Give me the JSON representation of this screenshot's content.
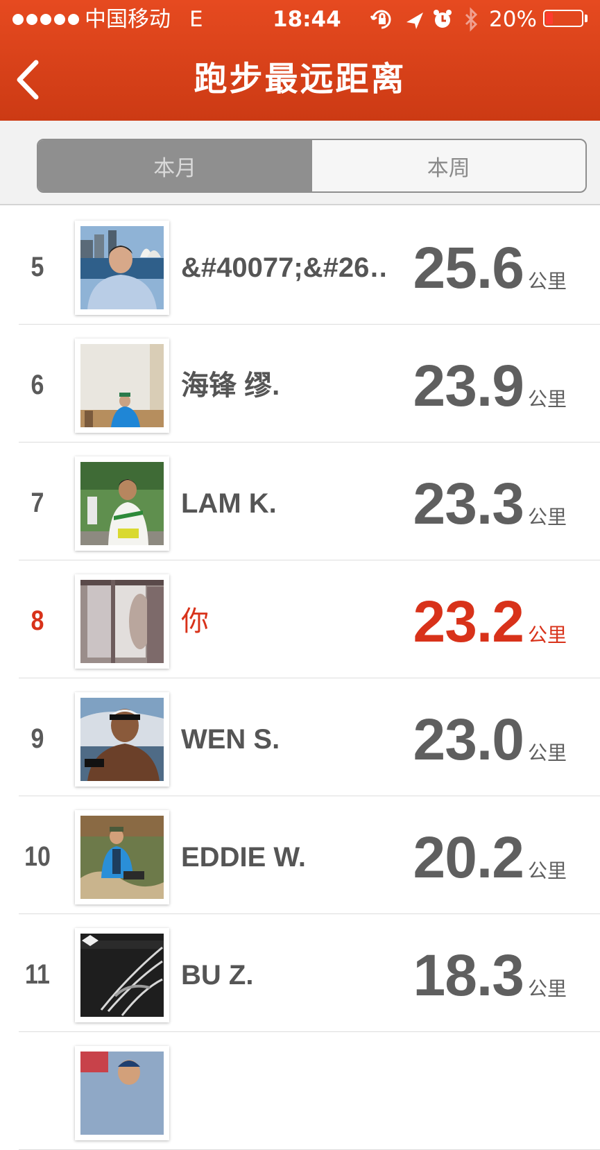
{
  "status_bar": {
    "carrier": "中国移动",
    "network": "E",
    "time": "18:44",
    "battery_percent": "20%",
    "battery_level": 0.2,
    "icons": [
      "rotation-lock-icon",
      "location-arrow-icon",
      "alarm-icon",
      "bluetooth-icon"
    ]
  },
  "nav": {
    "title": "跑步最远距离",
    "back_icon": "chevron-left-icon"
  },
  "segments": [
    {
      "label": "本月",
      "selected": true
    },
    {
      "label": "本周",
      "selected": false
    }
  ],
  "leaderboard": {
    "unit": "公里",
    "rows": [
      {
        "rank": "5",
        "name": "&#40077;&#26…",
        "distance": "25.6",
        "is_me": false
      },
      {
        "rank": "6",
        "name": "海锋 缪.",
        "distance": "23.9",
        "is_me": false
      },
      {
        "rank": "7",
        "name": "LAM K.",
        "distance": "23.3",
        "is_me": false
      },
      {
        "rank": "8",
        "name": "你",
        "distance": "23.2",
        "is_me": true
      },
      {
        "rank": "9",
        "name": "WEN S.",
        "distance": "23.0",
        "is_me": false
      },
      {
        "rank": "10",
        "name": "EDDIE W.",
        "distance": "20.2",
        "is_me": false
      },
      {
        "rank": "11",
        "name": "BU Z.",
        "distance": "18.3",
        "is_me": false
      }
    ]
  },
  "colors": {
    "header": "#d9401a",
    "highlight": "#d8321a",
    "text": "#5f5f5f"
  }
}
